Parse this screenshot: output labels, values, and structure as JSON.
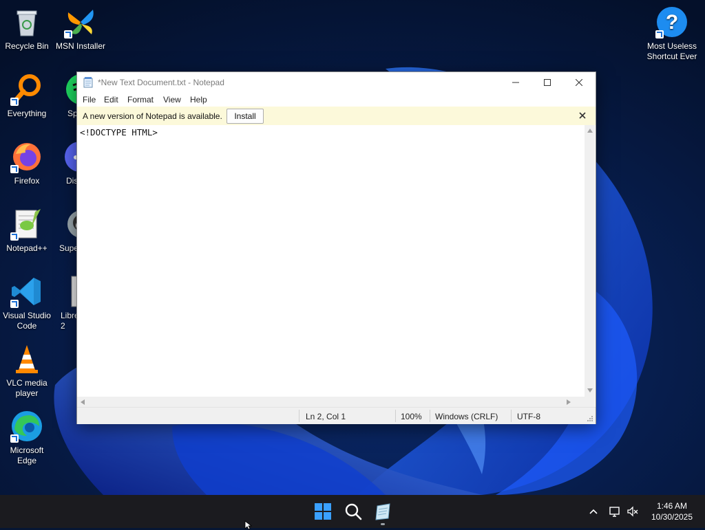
{
  "desktop": {
    "icons": [
      {
        "label": "Recycle Bin"
      },
      {
        "label": "MSN Installer"
      },
      {
        "label": "Most Useless Shortcut Ever"
      },
      {
        "label": "Everything"
      },
      {
        "label": "Sp"
      },
      {
        "label": "Firefox"
      },
      {
        "label": "Dis"
      },
      {
        "label": "Notepad++"
      },
      {
        "label": "Supe"
      },
      {
        "label": "Visual Studio Code"
      },
      {
        "label": "Libre\n2"
      },
      {
        "label": "VLC media player"
      },
      {
        "label": "Microsoft Edge"
      }
    ]
  },
  "notepad": {
    "title": "*New Text Document.txt - Notepad",
    "menu": [
      "File",
      "Edit",
      "Format",
      "View",
      "Help"
    ],
    "infobar": {
      "message": "A new version of Notepad is available.",
      "install_label": "Install"
    },
    "content": "<!DOCTYPE HTML>",
    "status": {
      "position": "Ln 2, Col 1",
      "zoom": "100%",
      "line_ending": "Windows (CRLF)",
      "encoding": "UTF-8"
    }
  },
  "taskbar": {
    "time": "1:46 AM",
    "date": "10/30/2025"
  },
  "colors": {
    "accent": "#1c6fd6",
    "wallpaper_dark": "#061633",
    "taskbar": "#1b1b1f",
    "infobar": "#fcf9da"
  }
}
